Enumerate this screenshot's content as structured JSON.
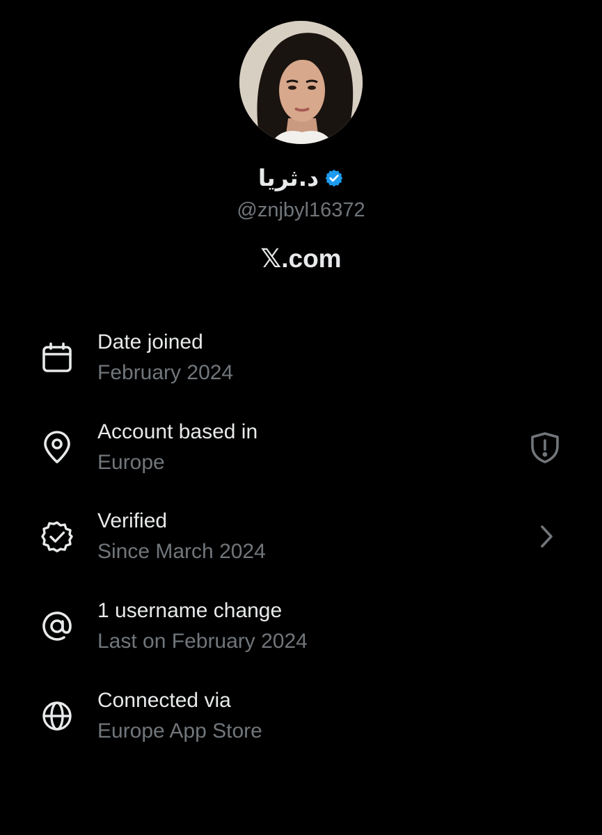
{
  "profile": {
    "display_name": "د.ثريا",
    "handle": "@znjbyl16372",
    "brand": "𝕏.com"
  },
  "colors": {
    "background": "#000000",
    "primary_text": "#e7e9ea",
    "secondary_text": "#71767b",
    "verified_badge": "#1d9bf0"
  },
  "info_items": [
    {
      "icon": "calendar-icon",
      "title": "Date joined",
      "subtitle": "February 2024"
    },
    {
      "icon": "location-pin-icon",
      "title": "Account based in",
      "subtitle": "Europe",
      "trailing_icon": "shield-alert-icon"
    },
    {
      "icon": "verified-check-icon",
      "title": "Verified",
      "subtitle": "Since March 2024",
      "trailing_icon": "chevron-right-icon"
    },
    {
      "icon": "at-sign-icon",
      "title": "1 username change",
      "subtitle": "Last on February 2024"
    },
    {
      "icon": "globe-icon",
      "title": "Connected via",
      "subtitle": "Europe App Store"
    }
  ]
}
